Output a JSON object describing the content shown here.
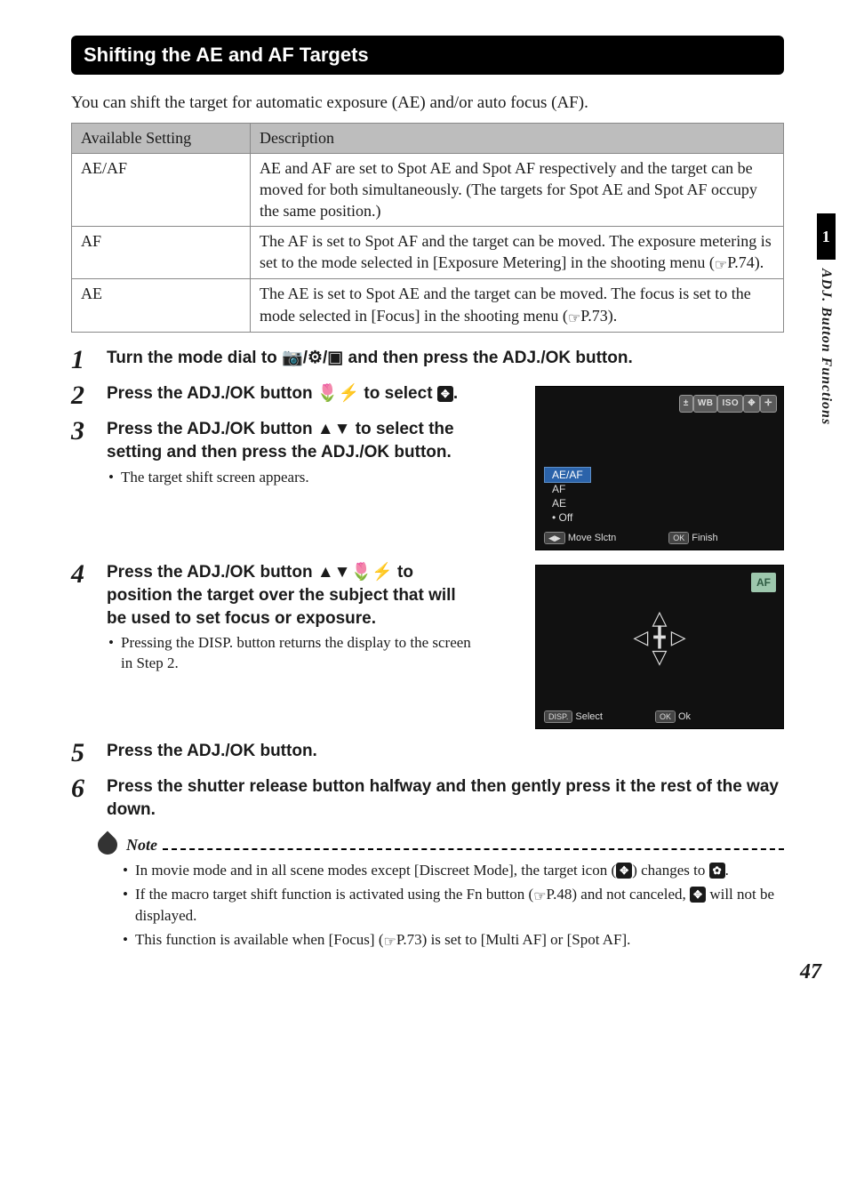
{
  "section_title": "Shifting the AE and AF Targets",
  "intro": "You can shift the target for automatic exposure (AE) and/or auto focus (AF).",
  "table": {
    "headers": {
      "col1": "Available Setting",
      "col2": "Description"
    },
    "rows": [
      {
        "setting": "AE/AF",
        "desc": "AE and AF are set to Spot AE and Spot AF respectively and the target can be moved for both simultaneously. (The targets for Spot AE and Spot AF occupy the same position.)"
      },
      {
        "setting": "AF",
        "desc_pre": "The AF is set to Spot AF and the target can be moved. The exposure metering is set to the mode selected in [Exposure Metering] in the shooting menu (",
        "desc_post": "P.74)."
      },
      {
        "setting": "AE",
        "desc_pre": "The AE is set to Spot AE and the target can be moved. The focus is set to the mode selected in [Focus] in the shooting menu (",
        "desc_post": "P.73)."
      }
    ]
  },
  "steps": [
    {
      "num": "1",
      "headline_parts": {
        "pre": "Turn the mode dial to ",
        "glyph": "📷/⚙/▣",
        "post": " and then press the ADJ./OK button."
      }
    },
    {
      "num": "2",
      "headline_parts": {
        "pre": "Press the ADJ./OK button ",
        "glyph": "🌷⚡",
        "mid": " to select ",
        "icon": "✥",
        "post": "."
      }
    },
    {
      "num": "3",
      "headline_parts": {
        "pre": "Press the ADJ./OK button ",
        "glyph": "▲▼",
        "post": " to select the setting and then press the ADJ./OK button."
      },
      "sub": [
        "The target shift screen appears."
      ]
    },
    {
      "num": "4",
      "headline_parts": {
        "pre": "Press the ADJ./OK button ",
        "glyph": "▲▼🌷⚡",
        "post": " to position the target over the subject that will be used to set focus or exposure."
      },
      "sub": [
        "Pressing the DISP. button returns the display to the screen in Step 2."
      ]
    },
    {
      "num": "5",
      "headline_parts": {
        "pre": "Press the ADJ./OK button."
      }
    },
    {
      "num": "6",
      "headline_parts": {
        "pre": "Press the shutter release button halfway and then gently press it the rest of the way down."
      }
    }
  ],
  "screen1": {
    "badges": [
      "±",
      "WB",
      "ISO",
      "✥",
      "✛"
    ],
    "options": {
      "o0": "AE/AF",
      "o1": "AF",
      "o2": "AE",
      "o3": "Off"
    },
    "bar": {
      "left_key": "◀▶",
      "left": "Move Slctn",
      "right_key": "OK",
      "right": "Finish"
    }
  },
  "screen2": {
    "badge": "AF",
    "bar": {
      "left_key": "DISP.",
      "left": "Select",
      "right_key": "OK",
      "right": "Ok"
    }
  },
  "note": {
    "title": "Note",
    "items": [
      {
        "pre": "In movie mode and in all scene modes except [Discreet Mode], the target icon (",
        "icon1": "✥",
        "mid": ") changes to ",
        "icon2": "✿",
        "post": "."
      },
      {
        "pre": "If the macro target shift function is activated using the Fn button (",
        "ref_post": "P.48) and not canceled, ",
        "icon": "✥",
        "post": " will not be displayed."
      },
      {
        "pre": "This function is available when [Focus] (",
        "ref_post": "P.73) is set to [Multi AF] or [Spot AF]."
      }
    ]
  },
  "side": {
    "chapter_num": "1",
    "label": "ADJ. Button Functions"
  },
  "page_number": "47"
}
